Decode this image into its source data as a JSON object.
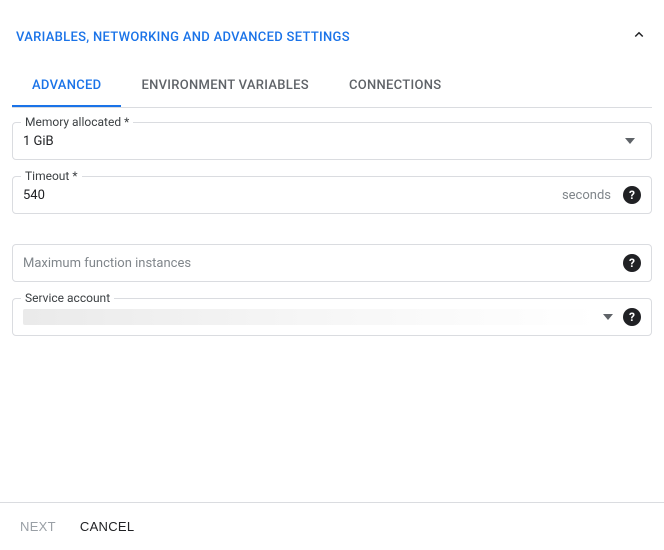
{
  "section_title": "VARIABLES, NETWORKING AND ADVANCED SETTINGS",
  "tabs": {
    "advanced": "ADVANCED",
    "env": "ENVIRONMENT VARIABLES",
    "conn": "CONNECTIONS"
  },
  "memory": {
    "label": "Memory allocated",
    "value": "1 GiB"
  },
  "timeout": {
    "label": "Timeout",
    "value": "540",
    "unit": "seconds"
  },
  "max_instances": {
    "placeholder": "Maximum function instances"
  },
  "service_account": {
    "label": "Service account"
  },
  "help_glyph": "?",
  "footer": {
    "next": "NEXT",
    "cancel": "CANCEL"
  }
}
